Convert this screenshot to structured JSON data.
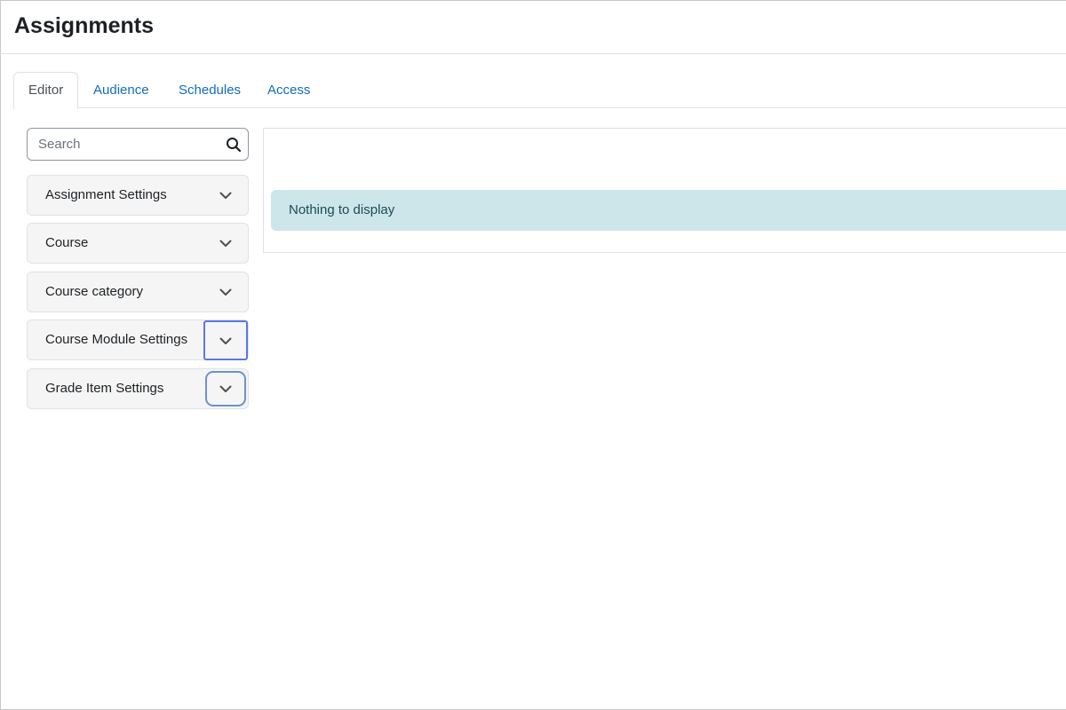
{
  "page": {
    "title": "Assignments"
  },
  "tabs": [
    {
      "label": "Editor",
      "active": true
    },
    {
      "label": "Audience",
      "active": false
    },
    {
      "label": "Schedules",
      "active": false
    },
    {
      "label": "Access",
      "active": false
    }
  ],
  "sidebar": {
    "search": {
      "placeholder": "Search",
      "value": "",
      "icon": "search-icon"
    },
    "sections": [
      {
        "label": "Assignment Settings",
        "icon": "chevron-down-icon"
      },
      {
        "label": "Course",
        "icon": "chevron-down-icon"
      },
      {
        "label": "Course category",
        "icon": "chevron-down-icon"
      },
      {
        "label": "Course Module Settings",
        "icon": "chevron-down-icon"
      },
      {
        "label": "Grade Item Settings",
        "icon": "chevron-down-icon"
      }
    ]
  },
  "main": {
    "empty_message": "Nothing to display"
  },
  "colors": {
    "link": "#0f6cbf",
    "alert_bg": "#cce6ea",
    "focus_ring": "#5b78e5"
  }
}
